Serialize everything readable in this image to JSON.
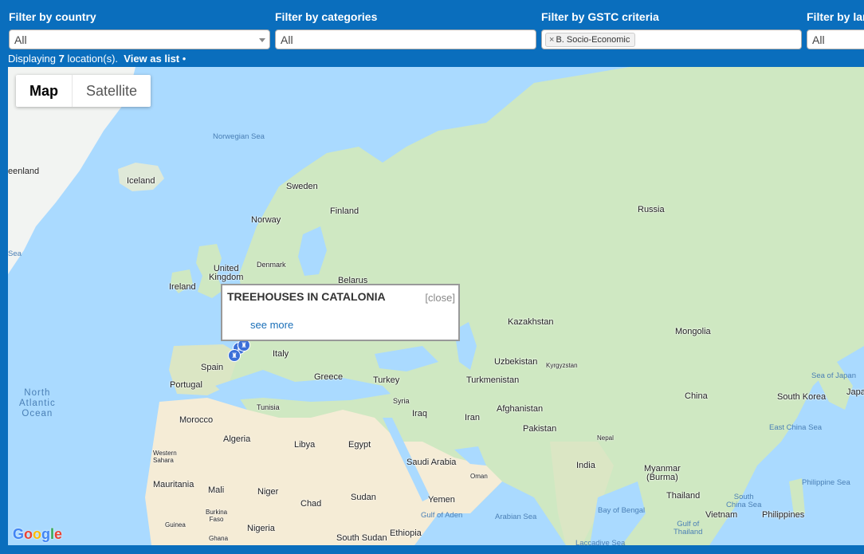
{
  "filters": [
    {
      "label": "Filter by country",
      "value": "All"
    },
    {
      "label": "Filter by categories",
      "value": "All"
    },
    {
      "label": "Filter by GSTC criteria",
      "tag": "B. Socio-Economic",
      "tag_remove": "×"
    },
    {
      "label": "Filter by lan",
      "value": "All"
    }
  ],
  "status": {
    "prefix": "Displaying ",
    "count": "7",
    "suffix": " location(s).",
    "list_link": "View as list",
    "bullet": "•"
  },
  "map_type": {
    "map": "Map",
    "satellite": "Satellite"
  },
  "popup": {
    "title": "TREEHOUSES IN CATALONIA",
    "close": "[close]",
    "link": "see more"
  },
  "labels": {
    "norwegian_sea": "Norwegian Sea",
    "greenland": "eenland",
    "iceland": "Iceland",
    "sweden": "Sweden",
    "finland": "Finland",
    "russia": "Russia",
    "norway": "Norway",
    "sea_left": "Sea",
    "united_kingdom": "United\nKingdom",
    "denmark": "Denmark",
    "ireland": "Ireland",
    "belarus": "Belarus",
    "kazakhstan": "Kazakhstan",
    "mongolia": "Mongolia",
    "italy": "Italy",
    "spain": "Spain",
    "uzbekistan": "Uzbekistan",
    "kyrgyzstan": "Kyrgyzstan",
    "portugal": "Portugal",
    "greece": "Greece",
    "turkey": "Turkey",
    "turkmenistan": "Turkmenistan",
    "sea_of_japan": "Sea of Japan",
    "japan": "Japa",
    "north_atlantic": "North\nAtlantic\nOcean",
    "syria": "Syria",
    "china": "China",
    "south_korea": "South Korea",
    "tunisia": "Tunisia",
    "iraq": "Iraq",
    "iran": "Iran",
    "afghanistan": "Afghanistan",
    "morocco": "Morocco",
    "east_china_sea": "East China Sea",
    "pakistan": "Pakistan",
    "algeria": "Algeria",
    "libya": "Libya",
    "egypt": "Egypt",
    "nepal": "Nepal",
    "western_sahara": "Western\nSahara",
    "saudi_arabia": "Saudi Arabia",
    "india": "India",
    "myanmar": "Myanmar\n(Burma)",
    "oman": "Oman",
    "mauritania": "Mauritania",
    "mali": "Mali",
    "niger": "Niger",
    "philippine_sea": "Philippine Sea",
    "sudan": "Sudan",
    "thailand": "Thailand",
    "chad": "Chad",
    "yemen": "Yemen",
    "south_china_sea": "South\nChina Sea",
    "gulf_of_aden": "Gulf of Aden",
    "arabian_sea": "Arabian Sea",
    "bay_of_bengal": "Bay of Bengal",
    "burkina_faso": "Burkina\nFaso",
    "vietnam": "Vietnam",
    "philippines": "Philippines",
    "guinea": "Guinea",
    "nigeria": "Nigeria",
    "gulf_of_thailand": "Gulf of\nThailand",
    "ethiopia": "Ethiopia",
    "ghana": "Ghana",
    "south_sudan": "South Sudan",
    "laccadive_sea": "Laccadive Sea"
  },
  "google": [
    "G",
    "o",
    "o",
    "g",
    "l",
    "e"
  ],
  "colors": {
    "header": "#0a6ebd",
    "water": "#aadaff",
    "land": "#cfe8c2",
    "desert": "#f5ecd6",
    "marker": "#3b6fd8"
  },
  "icons": {
    "marker": "location-marker-icon"
  }
}
